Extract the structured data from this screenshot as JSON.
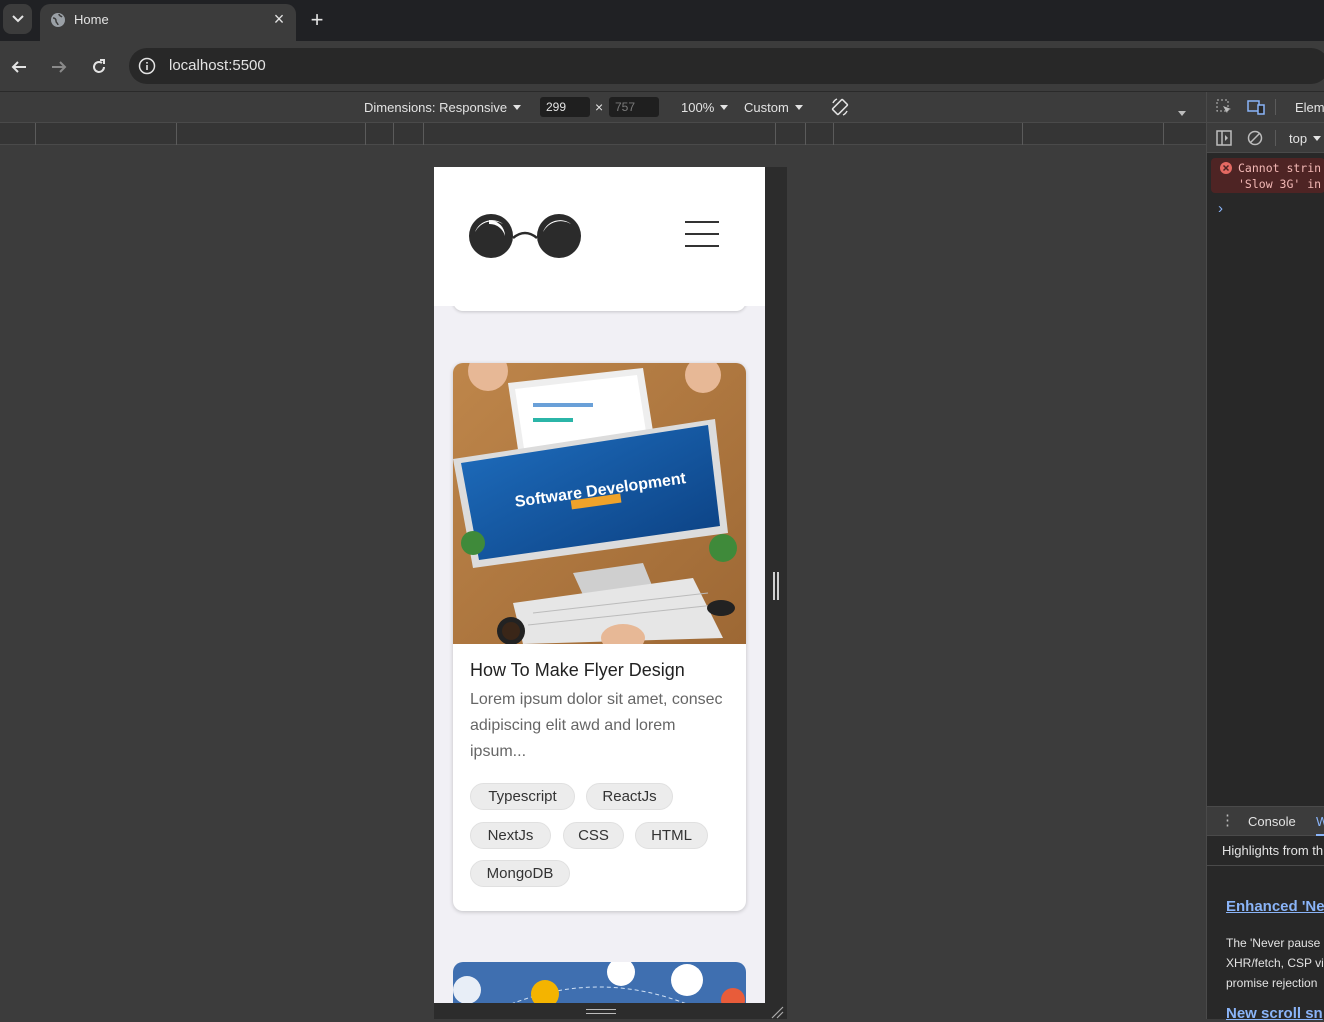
{
  "browser": {
    "tab_title": "Home",
    "url": "localhost:5500",
    "new_tab_symbol": "+",
    "close_symbol": "×"
  },
  "device_toolbar": {
    "dimensions_label": "Dimensions: Responsive",
    "width": "299",
    "height_placeholder": "757",
    "times": "×",
    "zoom": "100%",
    "throttle": "Custom"
  },
  "page": {
    "card": {
      "title": "How To Make Flyer Design",
      "description": "Lorem ipsum dolor sit amet, consec adipiscing elit awd and lorem ipsum...",
      "image_text": "Software Development",
      "tags": [
        "Typescript",
        "ReactJs",
        "NextJs",
        "CSS",
        "HTML",
        "MongoDB"
      ]
    }
  },
  "devtools": {
    "tab_elements": "Elem",
    "context": "top",
    "error_line1": "Cannot strin",
    "error_line2": "'Slow 3G' in",
    "prompt": "›",
    "drawer_console": "Console",
    "drawer_tab2": "W",
    "highlights": "Highlights from th",
    "heading1": "Enhanced 'Ne",
    "para1_l1": "The 'Never pause",
    "para1_l2": "XHR/fetch, CSP vi",
    "para1_l3": "promise rejection",
    "heading2": "New scroll sn"
  },
  "colors": {
    "accent": "#8ab4f8",
    "error_bg": "#4e2424",
    "error_text": "#f2b8b5",
    "page_bg": "#f1f0f5"
  }
}
